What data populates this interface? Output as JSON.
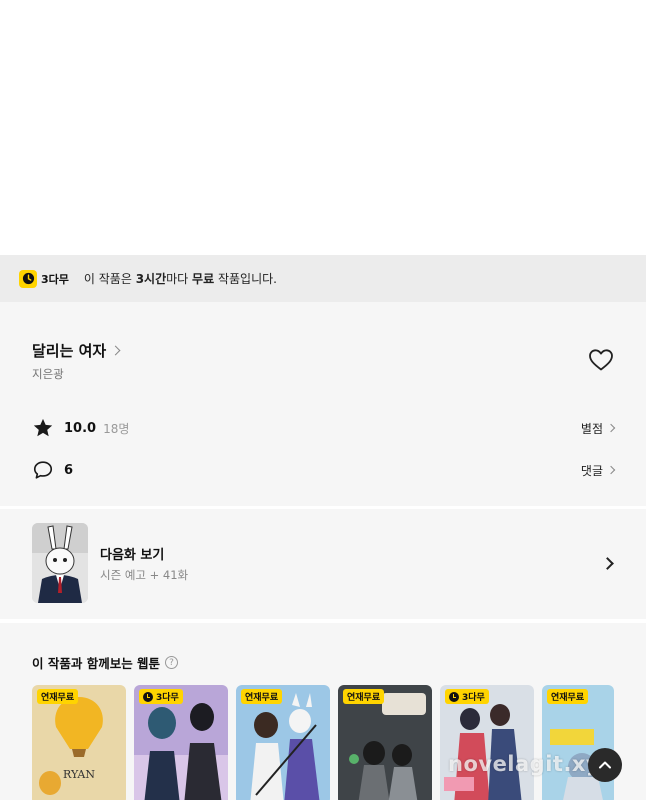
{
  "notice": {
    "badge_label": "3다무",
    "text_prefix": "이 작품은 ",
    "text_bold_time": "3시간",
    "text_mid": "마다 ",
    "text_bold_free": "무료",
    "text_suffix": " 작품입니다."
  },
  "work": {
    "title": "달리는 여자",
    "author": "지은광"
  },
  "rating": {
    "value": "10.0",
    "count": "18명",
    "link_label": "별점"
  },
  "comments": {
    "count": "6",
    "link_label": "댓글"
  },
  "next_episode": {
    "title": "다음화 보기",
    "subtitle": "시즌 예고 + 41화"
  },
  "recommendations": {
    "title": "이 작품과 함께보는 웹툰",
    "help": "?",
    "cards": [
      {
        "label": "연재무료",
        "clock": false,
        "bg": "#e9d7a8"
      },
      {
        "label": "3다무",
        "clock": true,
        "bg": "#b9a6d8"
      },
      {
        "label": "연재무료",
        "clock": false,
        "bg": "#9cc7e6"
      },
      {
        "label": "연재무료",
        "clock": false,
        "bg": "#3f4448"
      },
      {
        "label": "3다무",
        "clock": true,
        "bg": "#d9dfe6"
      },
      {
        "label": "연재무료",
        "clock": false,
        "bg": "#a9d3e8"
      }
    ]
  },
  "watermark": "novelagit.xyz"
}
